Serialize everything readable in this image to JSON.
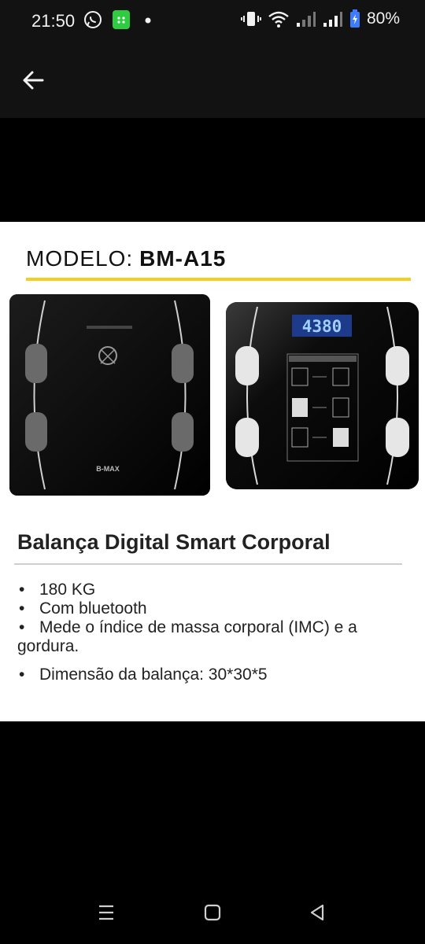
{
  "status_bar": {
    "time": "21:50",
    "battery_percent": "80%",
    "icons": [
      "whatsapp-icon",
      "app-notification-icon",
      "dot-icon",
      "vibrate-icon",
      "wifi-icon",
      "signal-icon",
      "signal-icon",
      "battery-charging-icon"
    ]
  },
  "app_bar": {
    "back_icon": "arrow-left-icon"
  },
  "product": {
    "model_label": "MODELO:",
    "model_value": "BM-A15",
    "brand_on_scale": "B-MAX",
    "display_reading": "4380",
    "title": "Balança Digital Smart Corporal",
    "features": [
      "180 KG",
      "Com bluetooth",
      "Mede o índice de massa corporal (IMC) e a gordura.",
      "Dimensão da balança: 30*30*5"
    ]
  },
  "colors": {
    "accent_line": "#f3cf20",
    "display_blue": "#3d7bff",
    "background": "#000000"
  },
  "nav_bar": {
    "buttons": [
      "recent-apps-icon",
      "home-icon",
      "back-triangle-icon"
    ]
  }
}
